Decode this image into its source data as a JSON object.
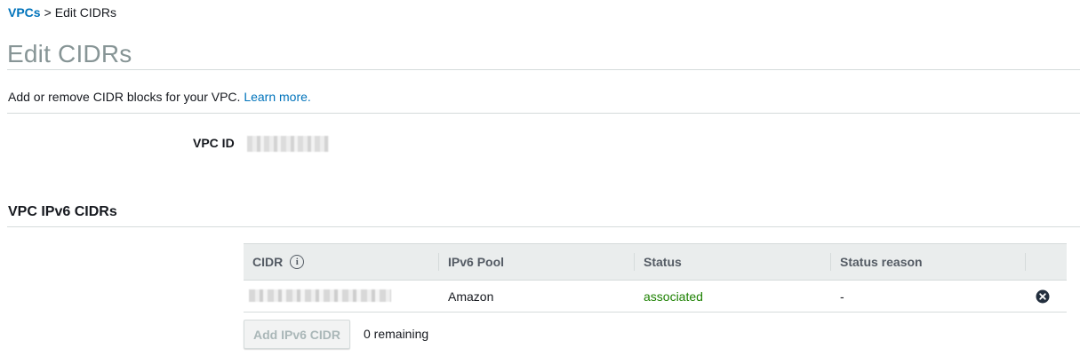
{
  "breadcrumb": {
    "root": "VPCs",
    "separator": ">",
    "current": "Edit CIDRs"
  },
  "page": {
    "title": "Edit CIDRs",
    "description": "Add or remove CIDR blocks for your VPC.",
    "learn_more": "Learn more."
  },
  "vpc": {
    "id_label": "VPC ID",
    "id_value": ""
  },
  "ipv6_section": {
    "title": "VPC IPv6 CIDRs",
    "columns": {
      "cidr": "CIDR",
      "pool": "IPv6 Pool",
      "status": "Status",
      "status_reason": "Status reason"
    },
    "rows": [
      {
        "cidr": "",
        "pool": "Amazon",
        "status": "associated",
        "status_reason": "-"
      }
    ],
    "add_button": "Add IPv6 CIDR",
    "add_button_disabled": true,
    "remaining": "0 remaining"
  },
  "colors": {
    "link": "#0073bb",
    "status_ok": "#1d8102",
    "title_gray": "#879596"
  },
  "icons": {
    "cidr_info": "info-icon",
    "row_remove": "remove-circle-x-icon"
  }
}
